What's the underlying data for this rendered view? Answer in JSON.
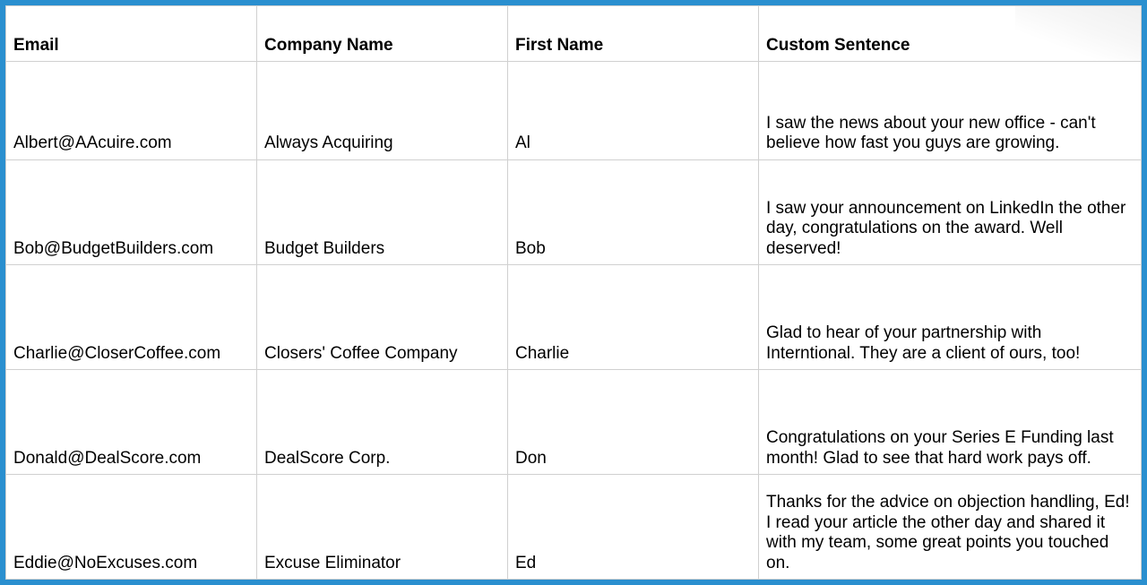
{
  "headers": {
    "email": "Email",
    "company": "Company Name",
    "first": "First Name",
    "custom": "Custom Sentence"
  },
  "rows": [
    {
      "email": "Albert@AAcuire.com",
      "company": "Always Acquiring",
      "first": "Al",
      "custom": "I saw the news about your new office - can't believe how fast you guys are growing."
    },
    {
      "email": "Bob@BudgetBuilders.com",
      "company": "Budget Builders",
      "first": "Bob",
      "custom": "I saw your announcement on LinkedIn the other day, congratulations on the award. Well deserved!"
    },
    {
      "email": "Charlie@CloserCoffee.com",
      "company": "Closers' Coffee Company",
      "first": "Charlie",
      "custom": "Glad to hear of your partnership with Interntional. They are a client of ours, too!"
    },
    {
      "email": "Donald@DealScore.com",
      "company": "DealScore Corp.",
      "first": "Don",
      "custom": "Congratulations on your Series E Funding last month! Glad to see that hard work pays off."
    },
    {
      "email": "Eddie@NoExcuses.com",
      "company": "Excuse Eliminator",
      "first": "Ed",
      "custom": "Thanks for the advice on objection handling, Ed! I read your article the other day and shared it with my team, some great points you touched on."
    }
  ]
}
